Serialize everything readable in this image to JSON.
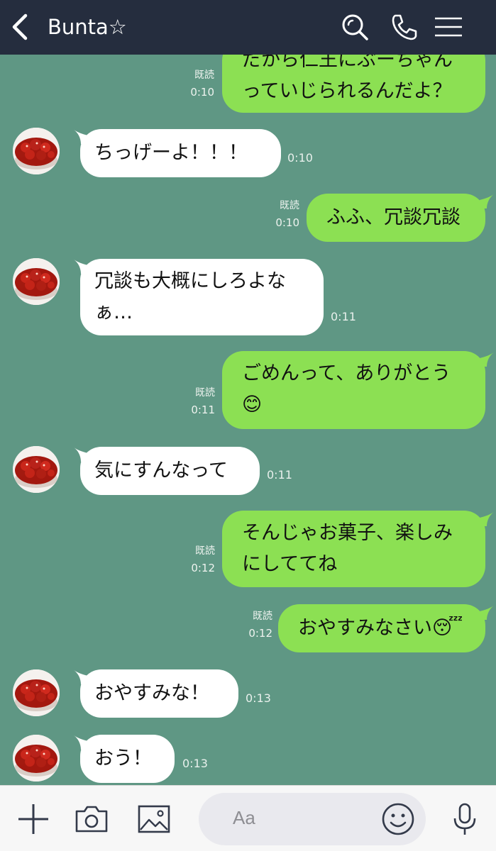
{
  "header": {
    "title": "Bunta☆",
    "back_icon": "chevron-left-icon",
    "search_icon": "search-icon",
    "call_icon": "phone-icon",
    "menu_icon": "menu-icon",
    "background": "#252d3e"
  },
  "chat": {
    "background": "#5f9784",
    "sent_bubble_color": "#8ce053",
    "received_bubble_color": "#ffffff",
    "messages": [
      {
        "direction": "out",
        "lines": [
          "だから仁王にぶーちゃん",
          "っていじられるんだよ？"
        ],
        "read": "既読",
        "time": "0:10"
      },
      {
        "direction": "in",
        "lines": [
          "ちっげーよ！！！"
        ],
        "time": "0:10"
      },
      {
        "direction": "out",
        "lines": [
          "ふふ、冗談冗談"
        ],
        "read": "既読",
        "time": "0:10"
      },
      {
        "direction": "in",
        "lines": [
          "冗談も大概にしろよな",
          "ぁ…"
        ],
        "time": "0:11"
      },
      {
        "direction": "out",
        "lines": [
          "ごめんって、ありがとう",
          "😊"
        ],
        "read": "既読",
        "time": "0:11"
      },
      {
        "direction": "in",
        "lines": [
          "気にすんなって"
        ],
        "time": "0:11"
      },
      {
        "direction": "out",
        "lines": [
          "そんじゃお菓子、楽しみ",
          "にしててね"
        ],
        "read": "既読",
        "time": "0:12"
      },
      {
        "direction": "out",
        "lines": [
          "おやすみなさい😴"
        ],
        "read": "既読",
        "time": "0:12"
      },
      {
        "direction": "in",
        "lines": [
          "おやすみな！"
        ],
        "time": "0:13"
      },
      {
        "direction": "in",
        "lines": [
          "おう！"
        ],
        "time": "0:13"
      }
    ]
  },
  "composer": {
    "placeholder": "Aa",
    "plus_icon": "plus-icon",
    "camera_icon": "camera-icon",
    "image_icon": "image-icon",
    "emoji_icon": "emoji-icon",
    "mic_icon": "microphone-icon"
  }
}
